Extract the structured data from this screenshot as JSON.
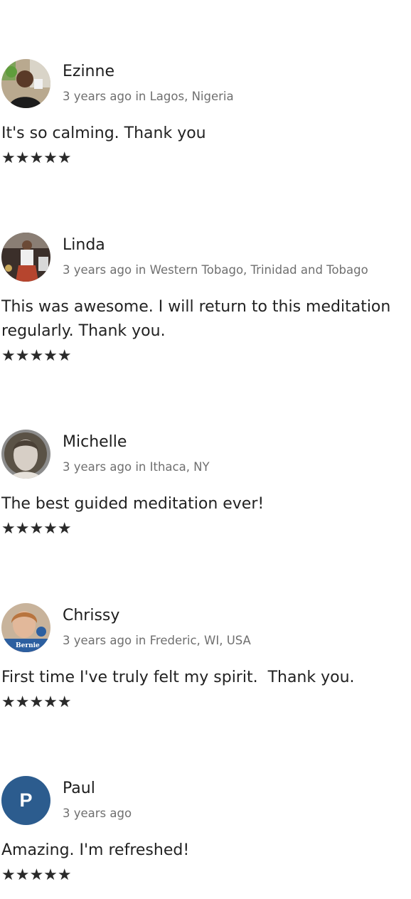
{
  "reviews": [
    {
      "name": "Ezinne",
      "meta": "3 years ago in Lagos, Nigeria",
      "text": "It's so calming. Thank you",
      "stars": "★★★★★",
      "avatar_icon": "photo-avatar"
    },
    {
      "name": "Linda",
      "meta": "3 years ago in Western Tobago, Trinidad and Tobago",
      "text": "This was awesome. I will return to this meditation\nregularly. Thank you.",
      "stars": "★★★★★",
      "avatar_icon": "photo-avatar"
    },
    {
      "name": "Michelle",
      "meta": "3 years ago in Ithaca, NY",
      "text": "The best guided meditation ever!",
      "stars": "★★★★★",
      "avatar_icon": "photo-avatar"
    },
    {
      "name": "Chrissy",
      "meta": "3 years ago in Frederic, WI, USA",
      "text": "First time I've truly felt my spirit.  Thank you.",
      "stars": "★★★★★",
      "avatar_icon": "photo-avatar",
      "avatar_badge": "Bernie"
    },
    {
      "name": "Paul",
      "meta": "3 years ago",
      "text": "Amazing. I'm refreshed!",
      "stars": "★★★★★",
      "avatar_initial": "P",
      "avatar_color": "#2c5c8e"
    }
  ],
  "rating": 5,
  "colors": {
    "text": "#222222",
    "meta": "#6f6f6f",
    "initial_avatar": "#2c5c8e"
  }
}
